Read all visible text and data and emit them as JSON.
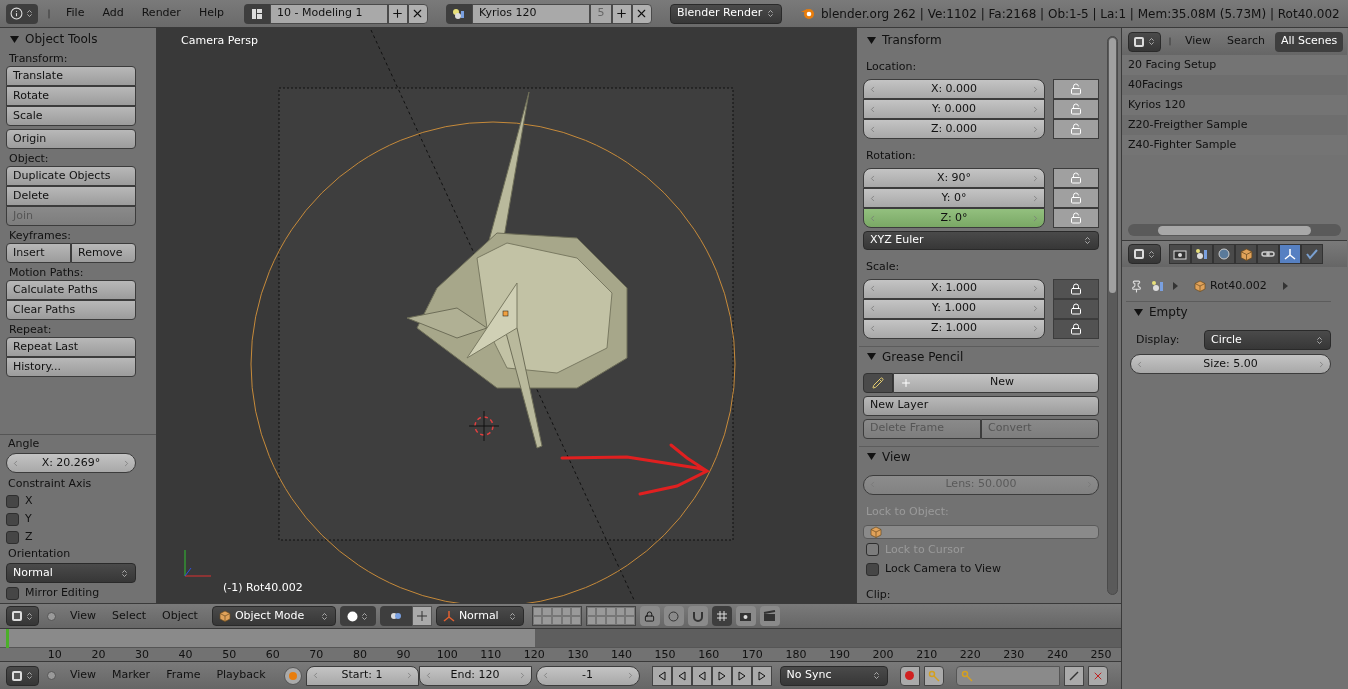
{
  "top_bar": {
    "menus": [
      "File",
      "Add",
      "Render",
      "Help"
    ],
    "screen_layout": "10 - Modeling 1",
    "scene": "Kyrios 120",
    "scene_users": "5",
    "render_engine": "Blender Render",
    "stats": "blender.org 262 | Ve:1102 | Fa:2168 | Ob:1-5 | La:1 | Mem:35.08M (5.73M) | Rot40.002"
  },
  "tool_shelf": {
    "title": "Object Tools",
    "expanded": true,
    "groups": [
      {
        "label": "Transform:",
        "kind": "column",
        "buttons": [
          {
            "label": "Translate",
            "disabled": false
          },
          {
            "label": "Rotate",
            "disabled": false
          },
          {
            "label": "Scale",
            "disabled": false
          }
        ]
      },
      {
        "kind": "column",
        "buttons": [
          {
            "label": "Origin",
            "disabled": false
          }
        ]
      },
      {
        "label": "Object:",
        "kind": "column",
        "buttons": [
          {
            "label": "Duplicate Objects",
            "disabled": false
          },
          {
            "label": "Delete",
            "disabled": false
          },
          {
            "label": "Join",
            "disabled": true
          }
        ]
      },
      {
        "label": "Keyframes:",
        "kind": "row",
        "buttons": [
          {
            "label": "Insert",
            "disabled": false
          },
          {
            "label": "Remove",
            "disabled": false
          }
        ]
      },
      {
        "label": "Motion Paths:",
        "kind": "column",
        "buttons": [
          {
            "label": "Calculate Paths",
            "disabled": false
          },
          {
            "label": "Clear Paths",
            "disabled": false
          }
        ]
      },
      {
        "label": "Repeat:",
        "kind": "column",
        "buttons": [
          {
            "label": "Repeat Last",
            "disabled": false
          },
          {
            "label": "History...",
            "disabled": false
          }
        ]
      }
    ]
  },
  "operator_panel": {
    "angle_label": "Angle",
    "angle": "X: 20.269°",
    "axis_label": "Constraint Axis",
    "axes": [
      {
        "label": "X",
        "checked": false
      },
      {
        "label": "Y",
        "checked": false
      },
      {
        "label": "Z",
        "checked": false
      }
    ],
    "orientation_label": "Orientation",
    "orientation": "Normal",
    "mirror_editing": {
      "label": "Mirror Editing",
      "checked": false
    }
  },
  "viewport": {
    "title": "Camera Persp",
    "object_label": "(-1) Rot40.002"
  },
  "n_panel": {
    "transform": {
      "title": "Transform",
      "expanded": true,
      "location_label": "Location:",
      "location": [
        {
          "value": "X: 0.000",
          "locked": false,
          "selected": false
        },
        {
          "value": "Y: 0.000",
          "locked": false,
          "selected": false
        },
        {
          "value": "Z: 0.000",
          "locked": false,
          "selected": false
        }
      ],
      "rotation_label": "Rotation:",
      "rotation": [
        {
          "value": "X: 90°",
          "locked": false,
          "selected": false
        },
        {
          "value": "Y: 0°",
          "locked": false,
          "selected": false
        },
        {
          "value": "Z: 0°",
          "locked": false,
          "selected": true
        }
      ],
      "rotation_mode": "XYZ Euler",
      "scale_label": "Scale:",
      "scale": [
        {
          "value": "X: 1.000",
          "locked": true,
          "selected": false
        },
        {
          "value": "Y: 1.000",
          "locked": true,
          "selected": false
        },
        {
          "value": "Z: 1.000",
          "locked": true,
          "selected": false
        }
      ]
    },
    "grease_pencil": {
      "title": "Grease Pencil",
      "expanded": true,
      "new": "New",
      "new_layer": "New Layer",
      "delete_frame": {
        "label": "Delete Frame",
        "disabled": true
      },
      "convert": {
        "label": "Convert",
        "disabled": true
      }
    },
    "view": {
      "title": "View",
      "expanded": true,
      "lens": {
        "label": "Lens: 50.000",
        "disabled": true
      },
      "lock_object_label": "Lock to Object:",
      "lock_cursor": {
        "label": "Lock to Cursor",
        "checked": false,
        "disabled": true
      },
      "lock_camera": {
        "label": "Lock Camera to View",
        "checked": false,
        "disabled": false
      },
      "clip_label": "Clip:"
    }
  },
  "outliner": {
    "menus": [
      "View",
      "Search"
    ],
    "filter": "All Scenes",
    "scenes": [
      "20 Facing Setup",
      "40Facings",
      "Kyrios 120",
      "Z20-Freigther Sample",
      "Z40-Fighter Sample"
    ]
  },
  "properties": {
    "tabs": [
      {
        "kind": "render",
        "selected": false
      },
      {
        "kind": "scene",
        "selected": false
      },
      {
        "kind": "world",
        "selected": false
      },
      {
        "kind": "object",
        "selected": false
      },
      {
        "kind": "constraints",
        "selected": false
      },
      {
        "kind": "data",
        "selected": true
      },
      {
        "kind": "physics",
        "selected": false
      }
    ],
    "object": "Rot40.002",
    "panel": {
      "title": "Empty",
      "expanded": true
    },
    "display_label": "Display:",
    "display": "Circle",
    "size": "Size: 5.00"
  },
  "view3d_header": {
    "menus": [
      "View",
      "Select",
      "Object"
    ],
    "mode": "Object Mode",
    "orientation": "Normal"
  },
  "timeline": {
    "ticks": [
      "10",
      "20",
      "30",
      "40",
      "50",
      "60",
      "70",
      "80",
      "90",
      "100",
      "110",
      "120",
      "130",
      "140",
      "150",
      "160",
      "170",
      "180",
      "190",
      "200",
      "210",
      "220",
      "230",
      "240",
      "250"
    ]
  },
  "timeline_header": {
    "menus": [
      "View",
      "Marker",
      "Frame",
      "Playback"
    ],
    "start": "Start: 1",
    "end": "End: 120",
    "frame": "-1",
    "sync": "No Sync"
  }
}
